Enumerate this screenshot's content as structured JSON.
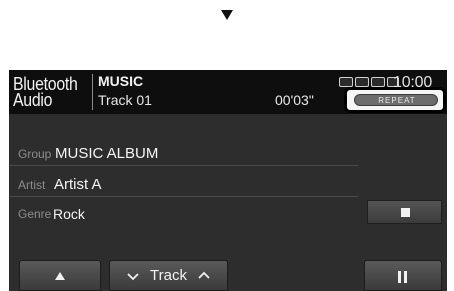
{
  "header": {
    "source_line1": "Bluetooth",
    "source_line2": "Audio",
    "title": "MUSIC",
    "track": "Track 01",
    "elapsed": "00'03\"",
    "clock": "10:00",
    "repeat_label": "REPEAT"
  },
  "info": [
    {
      "label": "Group",
      "value": "MUSIC ALBUM"
    },
    {
      "label": "Artist",
      "value": "Artist A"
    },
    {
      "label": "Genre",
      "value": "Rock"
    }
  ],
  "controls": {
    "track_label": "Track",
    "up_icon": "up-triangle-icon",
    "stop_icon": "stop-icon",
    "pause_icon": "pause-icon"
  },
  "colors": {
    "screen_bg": "#2d2d2d",
    "header_bg": "#0e0e0e",
    "highlight_border": "#000000"
  }
}
